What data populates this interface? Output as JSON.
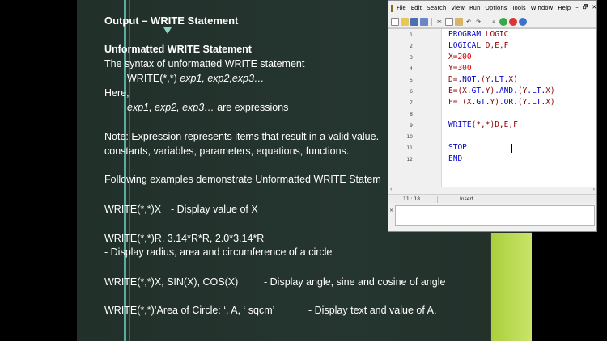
{
  "slide": {
    "title": "Output – WRITE Statement",
    "heading": "Unformatted WRITE Statement",
    "syntax_intro": "The syntax of unformatted WRITE statement",
    "syntax_call": "WRITE(*,*) ",
    "syntax_args": "exp1, exp2,exp3…",
    "here": "Here,",
    "exp_list": "exp1, exp2, exp3…",
    "exp_desc": "  are expressions",
    "note_1": "Note: Expression represents items that result in a valid value.",
    "note_2": "constants, variables, parameters, equations, functions.",
    "examples_intro": "Following examples demonstrate Unformatted WRITE Statem",
    "ex1_code": "WRITE(*,*)X",
    "ex1_desc": "- Display value of X",
    "ex2_code": "WRITE(*,*)R, 3.14*R*R, 2.0*3.14*R",
    "ex2_desc": "- Display radius, area and circumference of a circle",
    "ex3_code": "WRITE(*,*)X, SIN(X), COS(X)",
    "ex3_desc": "- Display angle, sine and cosine of angle",
    "ex4_code": "WRITE(*,*)’Area of Circle: ‘, A, ‘ sqcm’",
    "ex4_desc": "- Display text and value of A."
  },
  "editor": {
    "menu": [
      "File",
      "Edit",
      "Search",
      "View",
      "Run",
      "Options",
      "Tools",
      "Window",
      "Help"
    ],
    "window_controls": [
      "–",
      "🗗",
      "✕"
    ],
    "toolbar_icons": [
      "new-file-icon",
      "open-icon",
      "save-icon",
      "save-all-icon",
      "cut-icon",
      "copy-icon",
      "paste-icon",
      "undo-icon",
      "redo-icon",
      "find-icon",
      "run-icon",
      "stop-icon",
      "compile-icon"
    ],
    "line_numbers": [
      "1",
      "2",
      "3",
      "4",
      "5",
      "6",
      "7",
      "8",
      "9",
      "10",
      "11",
      "12"
    ],
    "lines": [
      {
        "a": "PROGRAM LOGIC"
      },
      {
        "a": "LOGICAL D,E,F"
      },
      {
        "a": "X=",
        "n": "200"
      },
      {
        "a": "Y=",
        "n": "300"
      },
      {
        "a": "D=.NOT.(Y.LT.X)"
      },
      {
        "a": "E=(X.GT.Y).AND.(Y.LT.X)"
      },
      {
        "a": "F= (X.GT.Y).OR.(Y.LT.X)"
      },
      {
        "a": ""
      },
      {
        "a": "WRITE(*,*)D,E,F"
      },
      {
        "a": ""
      },
      {
        "a": "STOP"
      },
      {
        "a": "END"
      }
    ],
    "status_position": "11 : 18",
    "status_mode": "Insert",
    "scroll_left": "‹",
    "scroll_right": "›",
    "output_marker": "×"
  },
  "colors": {
    "keyword": "#0000cc",
    "number": "#dd0000",
    "slide_bg": "#25352f",
    "accent_green": "#b5d94a"
  }
}
